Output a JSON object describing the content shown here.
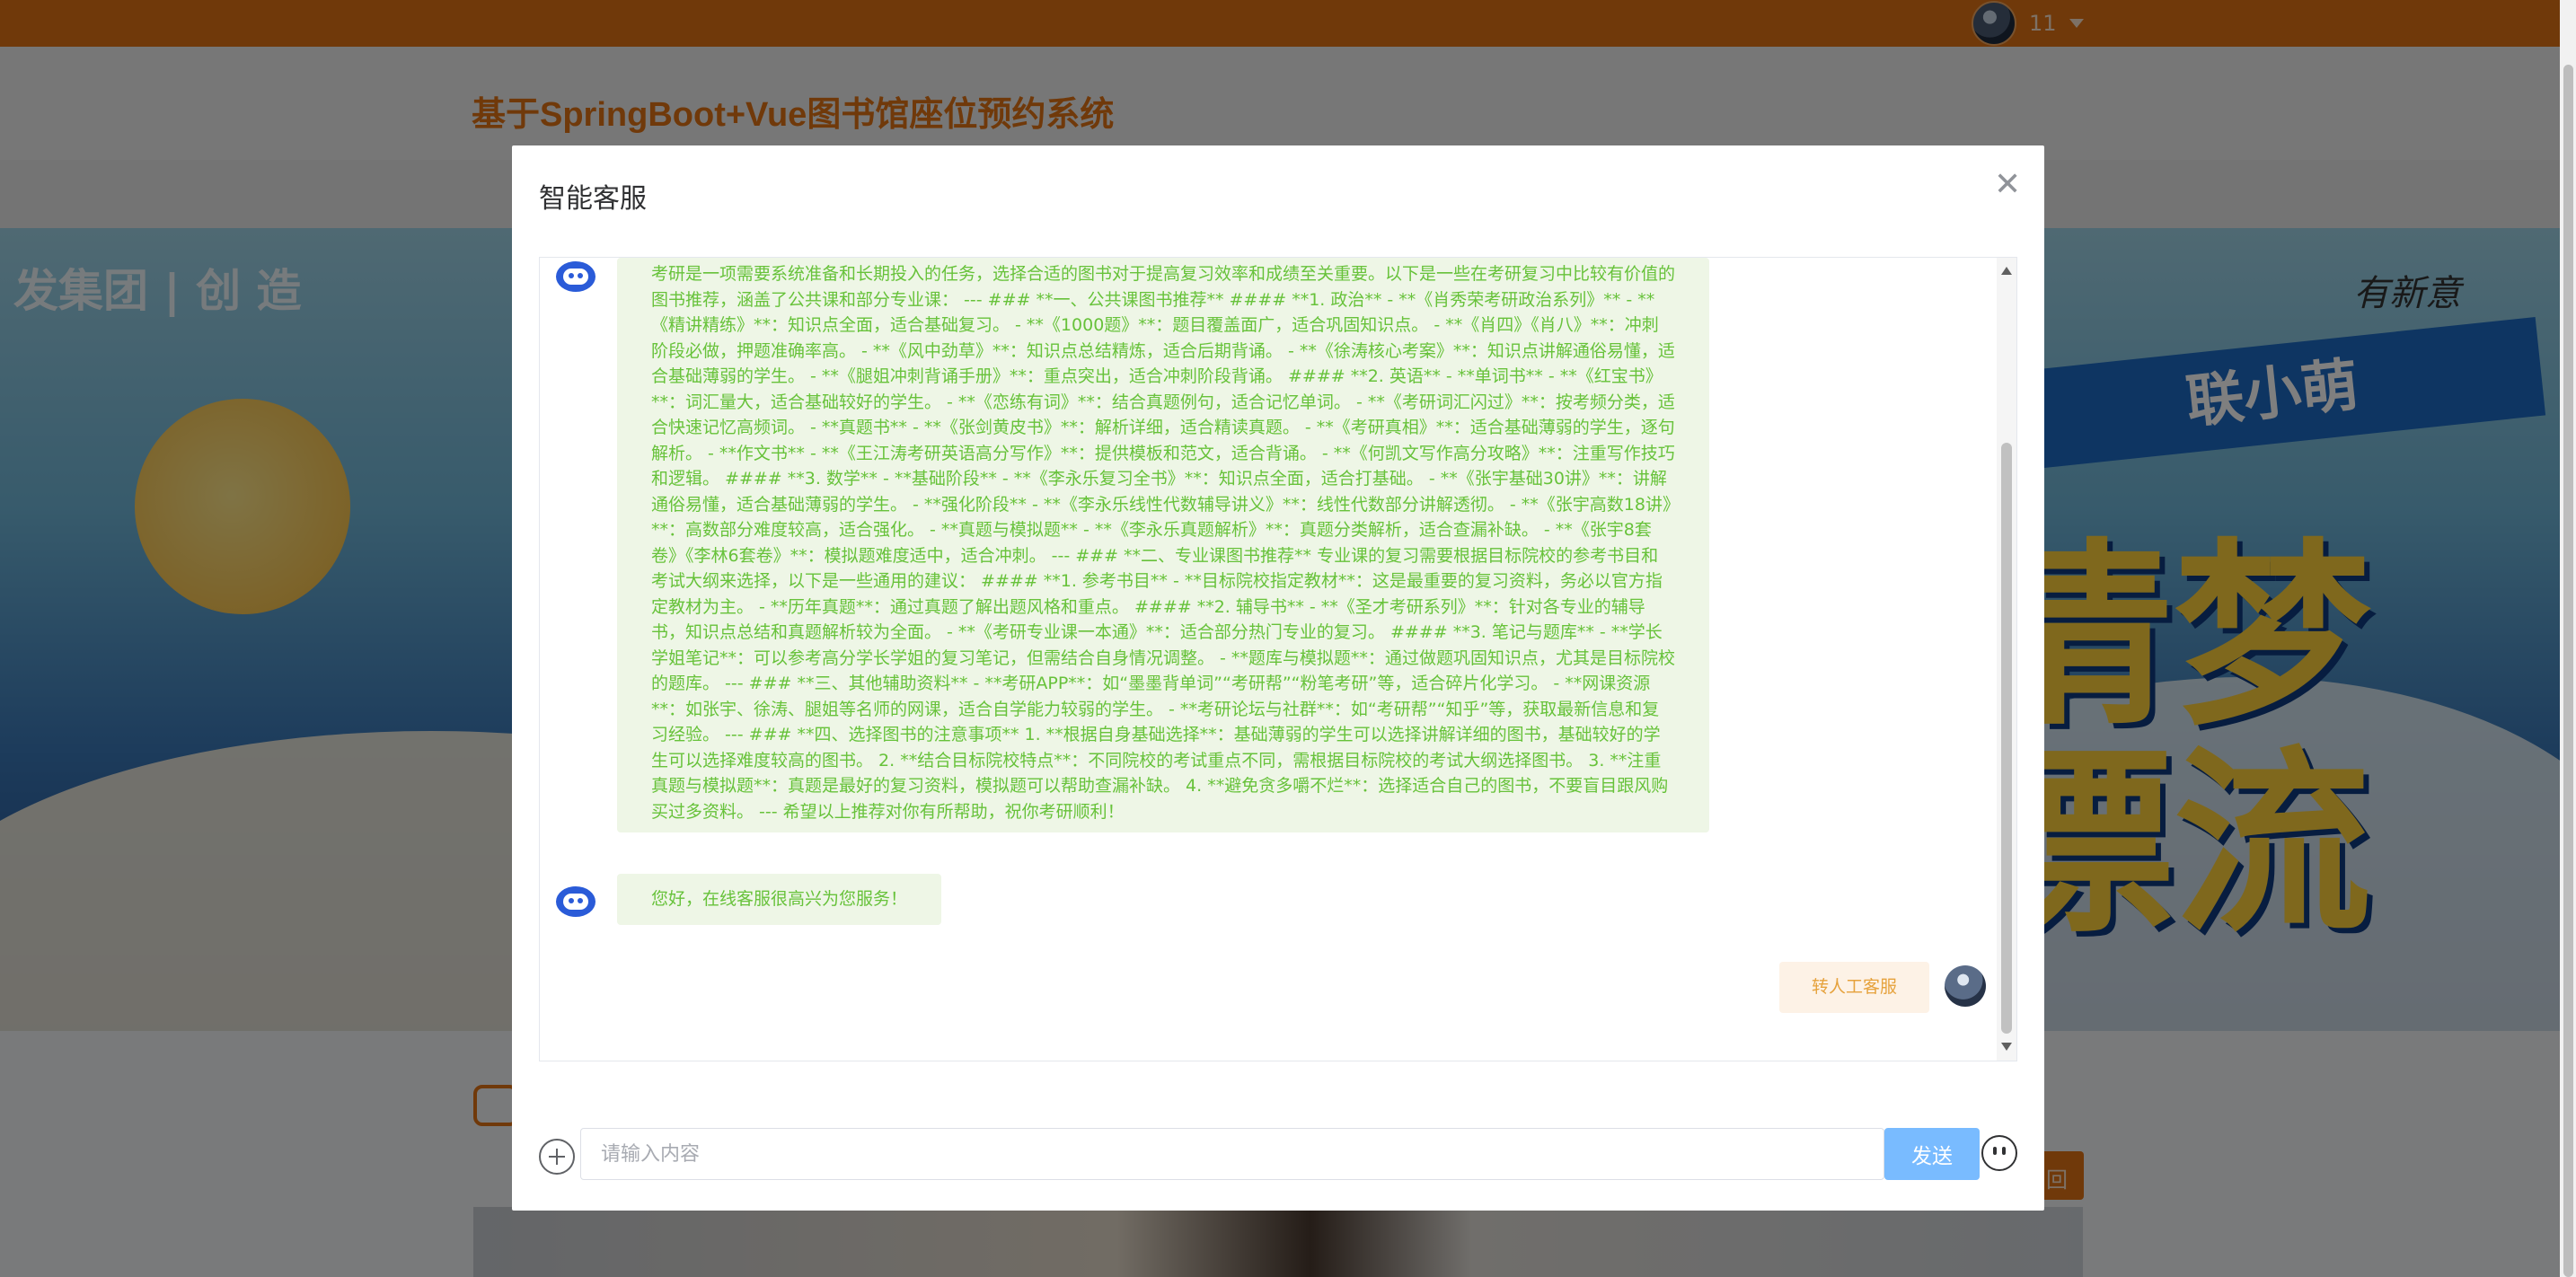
{
  "topbar": {
    "username": "11"
  },
  "header": {
    "site_title": "基于SpringBoot+Vue图书馆座位预约系统"
  },
  "banner": {
    "brand_left": "发集团 | 创 造",
    "brand_right": "联小萌",
    "signature": "有新意",
    "big_text": "清梦\n漂流"
  },
  "lower": {
    "button_label": "回"
  },
  "dialog": {
    "title": "智能客服",
    "close_icon": "close-icon",
    "messages": [
      {
        "role": "bot",
        "text": "考研是一项需要系统准备和长期投入的任务，选择合适的图书对于提高复习效率和成绩至关重要。以下是一些在考研复习中比较有价值的图书推荐，涵盖了公共课和部分专业课： --- ### **一、公共课图书推荐** #### **1. 政治** - **《肖秀荣考研政治系列》** - **《精讲精练》**：知识点全面，适合基础复习。 - **《1000题》**：题目覆盖面广，适合巩固知识点。 - **《肖四》《肖八》**：冲刺阶段必做，押题准确率高。 - **《风中劲草》**：知识点总结精炼，适合后期背诵。 - **《徐涛核心考案》**：知识点讲解通俗易懂，适合基础薄弱的学生。 - **《腿姐冲刺背诵手册》**：重点突出，适合冲刺阶段背诵。 #### **2. 英语** - **单词书** - **《红宝书》**：词汇量大，适合基础较好的学生。 - **《恋练有词》**：结合真题例句，适合记忆单词。 - **《考研词汇闪过》**：按考频分类，适合快速记忆高频词。 - **真题书** - **《张剑黄皮书》**：解析详细，适合精读真题。 - **《考研真相》**：适合基础薄弱的学生，逐句解析。 - **作文书** - **《王江涛考研英语高分写作》**：提供模板和范文，适合背诵。 - **《何凯文写作高分攻略》**：注重写作技巧和逻辑。 #### **3. 数学** - **基础阶段** - **《李永乐复习全书》**：知识点全面，适合打基础。 - **《张宇基础30讲》**：讲解通俗易懂，适合基础薄弱的学生。 - **强化阶段** - **《李永乐线性代数辅导讲义》**：线性代数部分讲解透彻。 - **《张宇高数18讲》**：高数部分难度较高，适合强化。 - **真题与模拟题** - **《李永乐真题解析》**：真题分类解析，适合查漏补缺。 - **《张宇8套卷》《李林6套卷》**：模拟题难度适中，适合冲刺。 --- ### **二、专业课图书推荐** 专业课的复习需要根据目标院校的参考书目和考试大纲来选择，以下是一些通用的建议： #### **1. 参考书目** - **目标院校指定教材**：这是最重要的复习资料，务必以官方指定教材为主。 - **历年真题**：通过真题了解出题风格和重点。 #### **2. 辅导书** - **《圣才考研系列》**：针对各专业的辅导书，知识点总结和真题解析较为全面。 - **《考研专业课一本通》**：适合部分热门专业的复习。 #### **3. 笔记与题库** - **学长学姐笔记**：可以参考高分学长学姐的复习笔记，但需结合自身情况调整。 - **题库与模拟题**：通过做题巩固知识点，尤其是目标院校的题库。 --- ### **三、其他辅助资料** - **考研APP**：如“墨墨背单词”“考研帮”“粉笔考研”等，适合碎片化学习。 - **网课资源**：如张宇、徐涛、腿姐等名师的网课，适合自学能力较弱的学生。 - **考研论坛与社群**：如“考研帮”“知乎”等，获取最新信息和复习经验。 --- ### **四、选择图书的注意事项** 1. **根据自身基础选择**：基础薄弱的学生可以选择讲解详细的图书，基础较好的学生可以选择难度较高的图书。 2. **结合目标院校特点**：不同院校的考试重点不同，需根据目标院校的考试大纲选择图书。 3. **注重真题与模拟题**：真题是最好的复习资料，模拟题可以帮助查漏补缺。 4. **避免贪多嚼不烂**：选择适合自己的图书，不要盲目跟风购买过多资料。 --- 希望以上推荐对你有所帮助，祝你考研顺利！"
      },
      {
        "role": "bot",
        "text": "您好，在线客服很高兴为您服务！"
      },
      {
        "role": "user",
        "text": "转人工客服"
      }
    ],
    "input": {
      "value": "",
      "placeholder": "请输入内容"
    },
    "send_label": "发送"
  }
}
